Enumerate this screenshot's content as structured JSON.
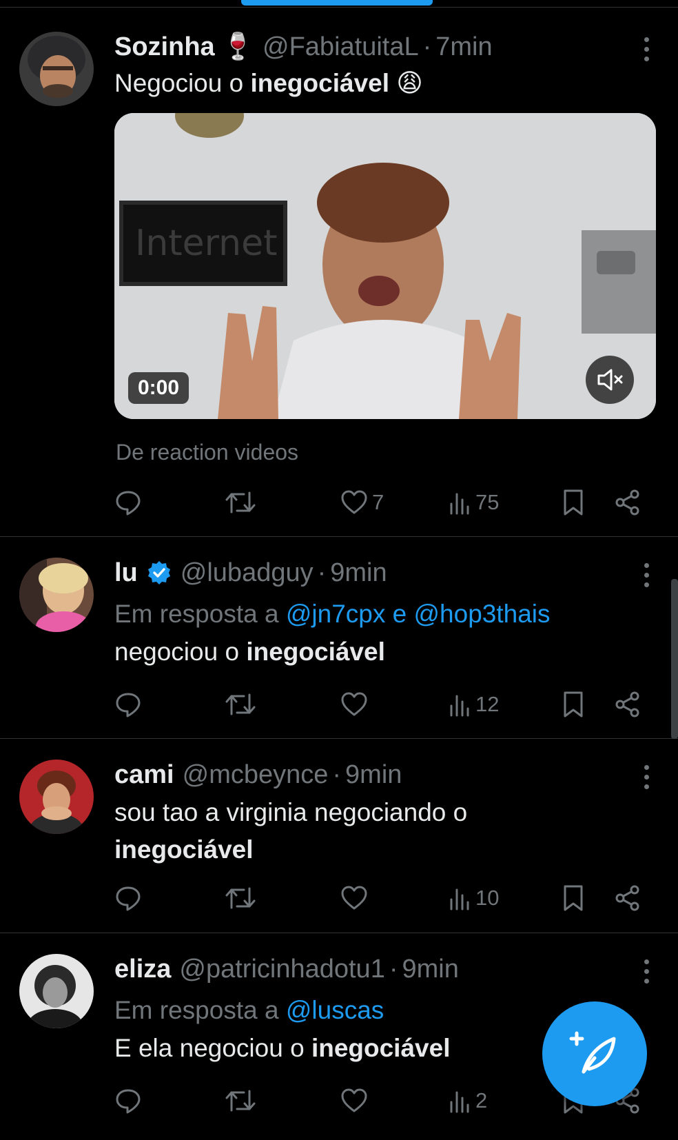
{
  "tweets": [
    {
      "name": "Sozinha",
      "name_emoji": "🍷",
      "handle": "@FabiatuitaL",
      "time": "7min",
      "text_before": "Negociou o ",
      "text_bold": "inegociável",
      "text_after": " 😩",
      "media": {
        "timecode": "0:00",
        "muted": true
      },
      "source": "De reaction videos",
      "stats": {
        "replies": "",
        "retweets": "",
        "likes": "7",
        "views": "75"
      }
    },
    {
      "name": "lu",
      "verified": true,
      "handle": "@lubadguy",
      "time": "9min",
      "reply_prefix": "Em resposta a ",
      "reply_mention_1": "@jn7cpx",
      "reply_joiner": " e ",
      "reply_mention_2": "@hop3thais",
      "text_before": "negociou o ",
      "text_bold": "inegociável",
      "stats": {
        "replies": "",
        "retweets": "",
        "likes": "",
        "views": "12"
      }
    },
    {
      "name": "cami",
      "handle": "@mcbeynce",
      "time": "9min",
      "text_before": "sou tao a virginia negociando o",
      "text_bold": "inegociável",
      "stats": {
        "replies": "",
        "retweets": "",
        "likes": "",
        "views": "10"
      }
    },
    {
      "name": "eliza",
      "handle": "@patricinhadotu1",
      "time": "9min",
      "reply_prefix": "Em resposta a ",
      "reply_mention_1": "@luscas",
      "text_before": "E ela negociou o ",
      "text_bold": "inegociável",
      "stats": {
        "replies": "",
        "retweets": "",
        "likes": "",
        "views": "2"
      }
    }
  ],
  "separator_dot": "·",
  "colors": {
    "accent": "#1d9bf0",
    "background": "#000000",
    "text_primary": "#e7e9ea",
    "text_secondary": "#71767b",
    "divider": "#2f3336"
  },
  "icons": {
    "reply": "reply-icon",
    "retweet": "retweet-icon",
    "like": "heart-icon",
    "views": "views-icon",
    "bookmark": "bookmark-icon",
    "share": "share-icon",
    "more": "more-icon",
    "compose": "compose-icon"
  }
}
